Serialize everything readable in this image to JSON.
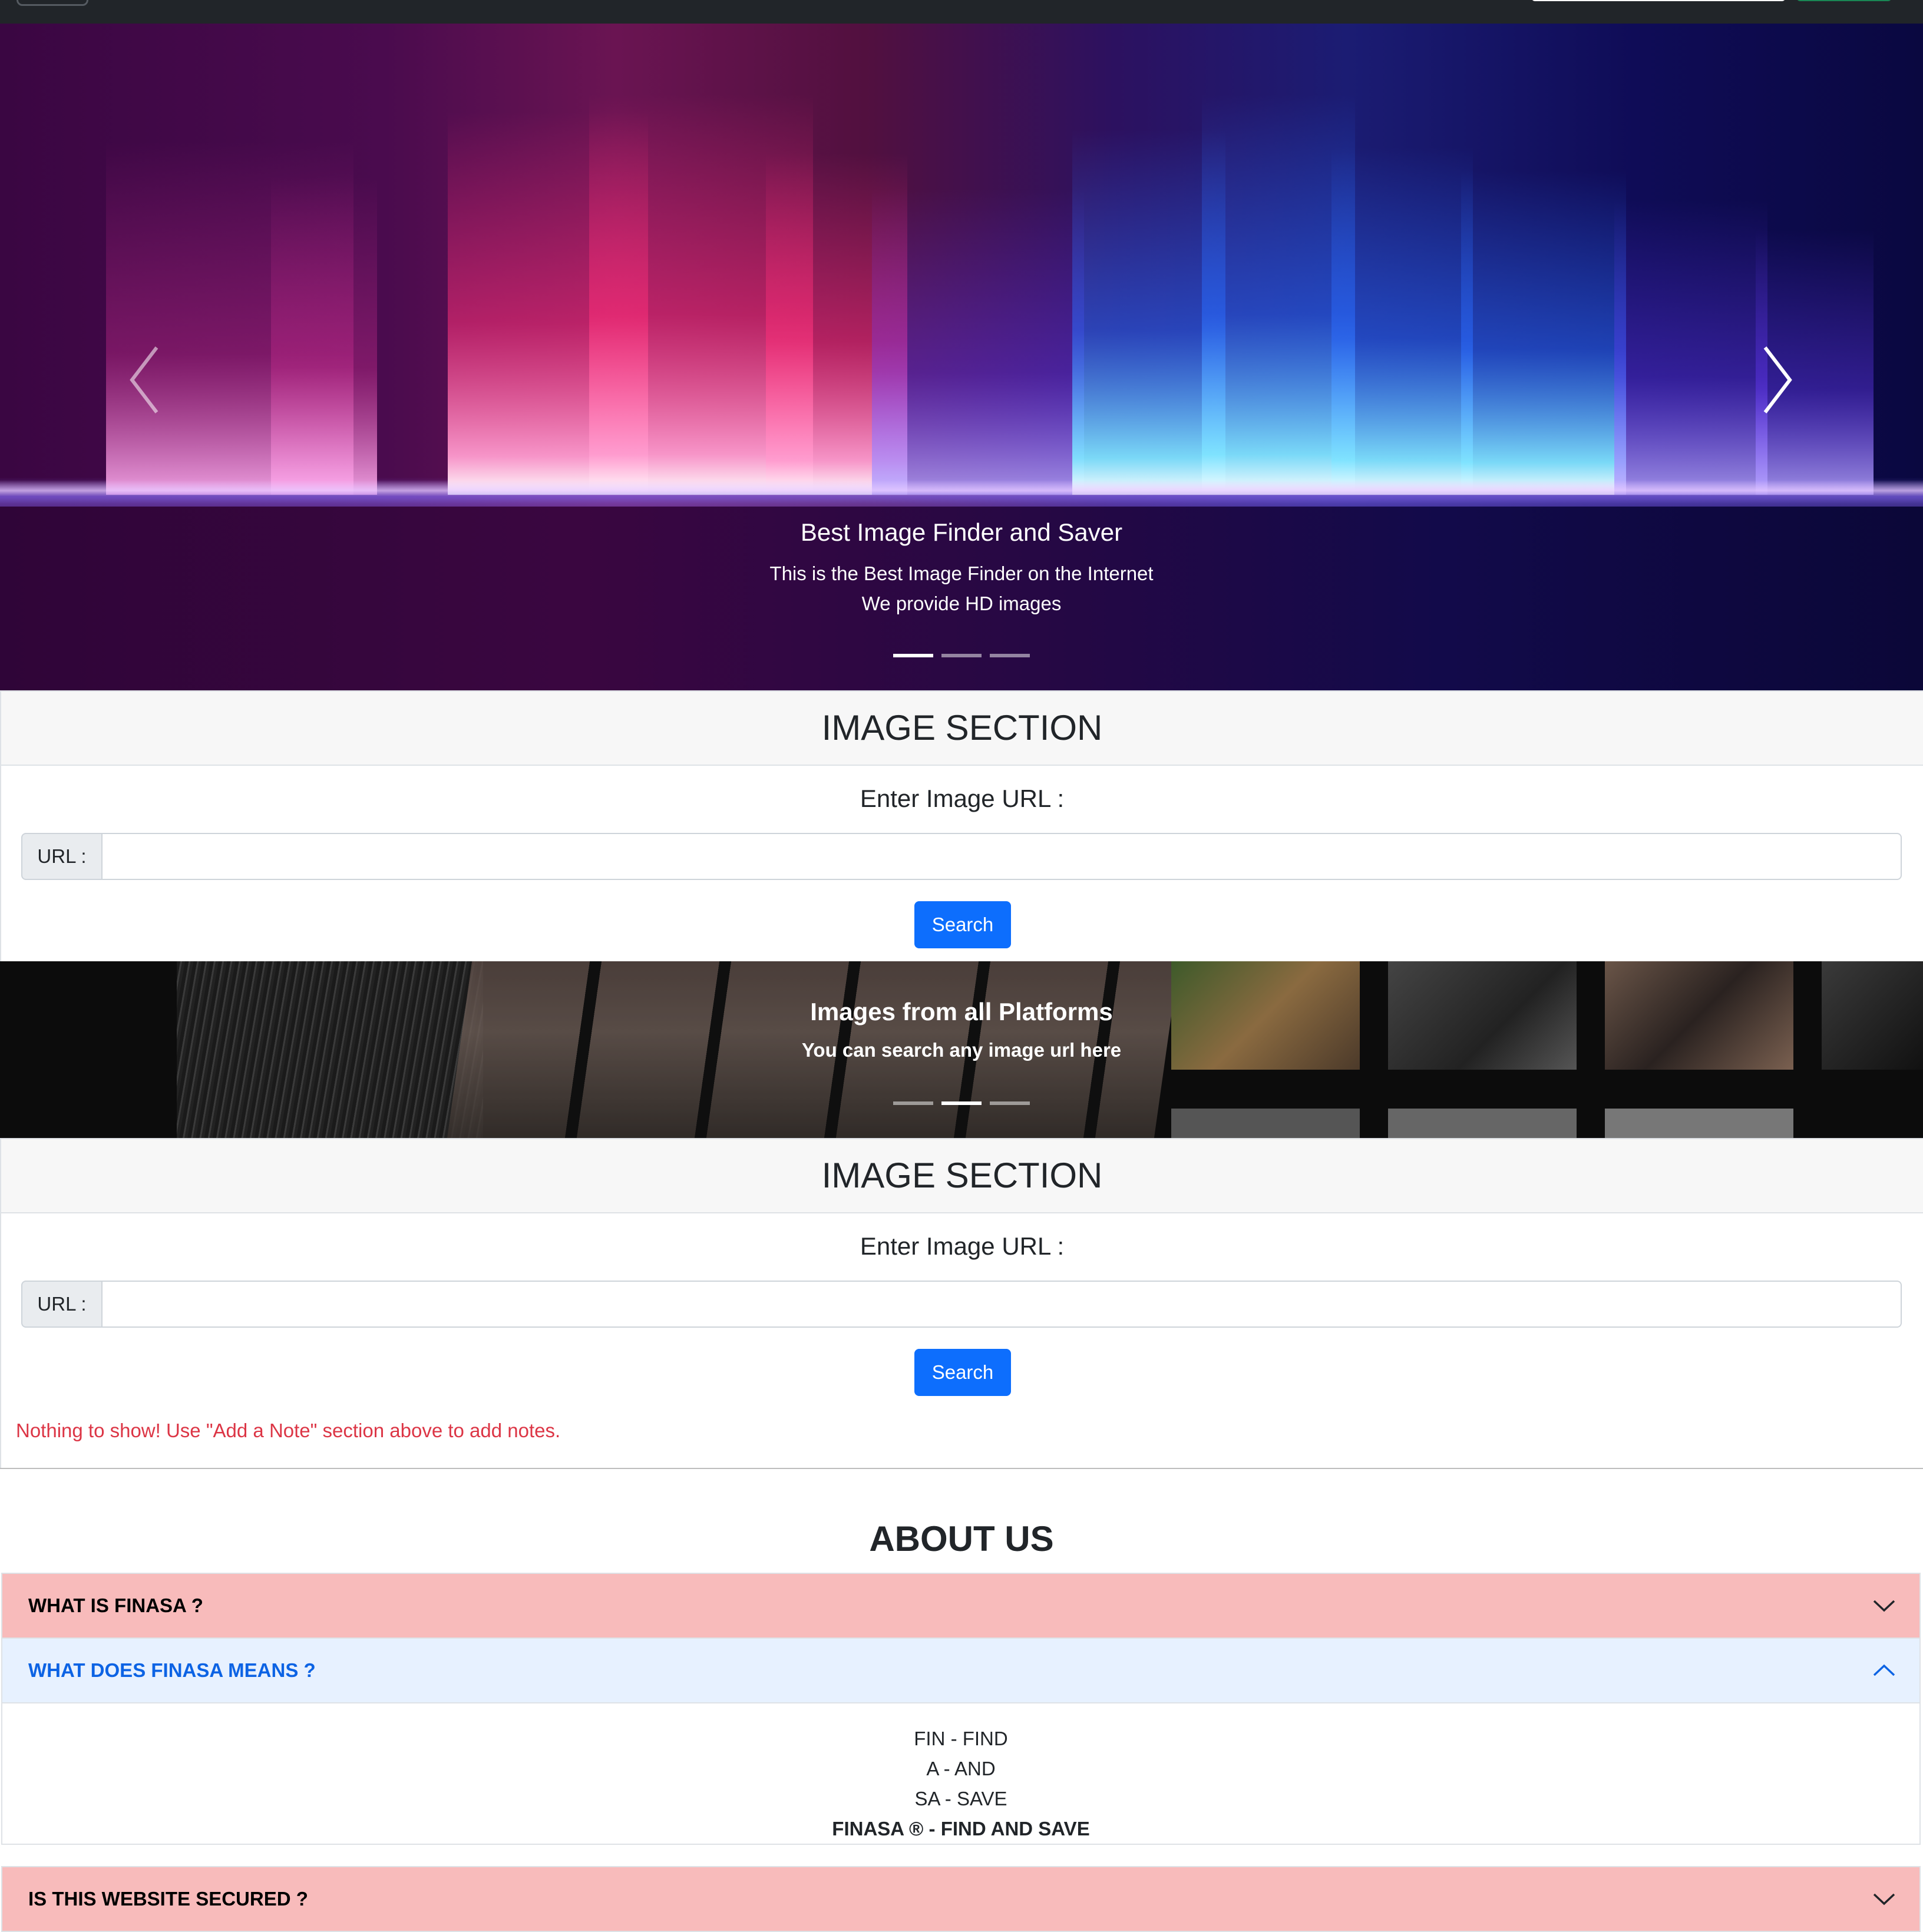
{
  "hero": {
    "title": "Best Image Finder and Saver",
    "line1": "This is the Best Image Finder on the Internet",
    "line2": "We provide HD images",
    "slides": 3,
    "active_slide": 1
  },
  "sections": [
    {
      "header": "IMAGE SECTION",
      "label": "Enter Image URL :",
      "input_prefix": "URL :",
      "input_value": "",
      "button": "Search"
    },
    {
      "header": "IMAGE SECTION",
      "label": "Enter Image URL :",
      "input_prefix": "URL :",
      "input_value": "",
      "button": "Search",
      "message": "Nothing to show! Use \"Add a Note\" section above to add notes."
    }
  ],
  "band": {
    "title": "Images from all Platforms",
    "subtitle": "You can search any image url here",
    "slides": 3,
    "active_slide": 2
  },
  "about": {
    "title": "ABOUT US",
    "items": [
      {
        "label": "WHAT IS FINASA ?",
        "expanded": false
      },
      {
        "label": "WHAT DOES FINASA MEANS ?",
        "expanded": true,
        "lines": [
          "FIN - FIND",
          "A - AND",
          "SA - SAVE"
        ],
        "bold_line": "FINASA ® - FIND AND SAVE"
      },
      {
        "label": "IS THIS WEBSITE SECURED ?",
        "expanded": false
      }
    ]
  },
  "colors": {
    "primary": "#0d6efd",
    "danger": "#dc3545",
    "accordion_collapsed": "#f8bbbb",
    "accordion_expanded": "#e7f1ff",
    "navbar": "#212529"
  },
  "icons": {
    "prev": "chevron-left-icon",
    "next": "chevron-right-icon",
    "collapsed": "chevron-down-icon",
    "expanded": "chevron-up-icon"
  }
}
